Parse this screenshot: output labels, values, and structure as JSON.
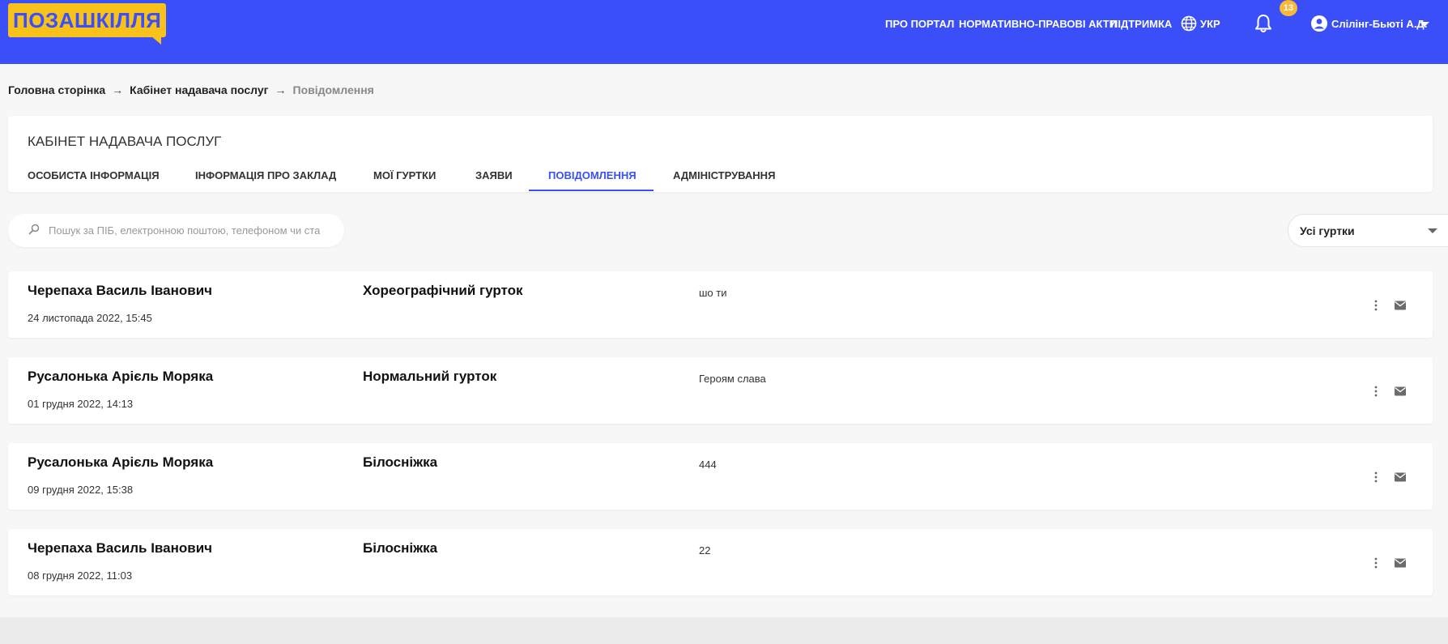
{
  "header": {
    "logo_text": "ПОЗАШКІЛЛЯ",
    "nav": [
      {
        "label": "ПРО ПОРТАЛ"
      },
      {
        "label": "НОРМАТИВНО-ПРАВОВІ АКТИ"
      },
      {
        "label": "ПІДТРИМКА"
      }
    ],
    "language": "УКР",
    "notifications_count": "13",
    "user_name": "Слілінг-Бьюті А.Д."
  },
  "breadcrumb": {
    "home": "Головна сторінка",
    "cabinet": "Кабінет надавача послуг",
    "current": "Повідомлення"
  },
  "cabinet": {
    "title": "КАБІНЕТ НАДАВАЧА ПОСЛУГ",
    "tabs": [
      {
        "label": "ОСОБИСТА ІНФОРМАЦІЯ"
      },
      {
        "label": "ІНФОРМАЦІЯ ПРО ЗАКЛАД"
      },
      {
        "label": "МОЇ ГУРТКИ"
      },
      {
        "label": "ЗАЯВИ"
      },
      {
        "label": "ПОВІДОМЛЕННЯ"
      },
      {
        "label": "АДМІНІСТРУВАННЯ"
      }
    ],
    "active_tab": "ПОВІДОМЛЕННЯ"
  },
  "search": {
    "placeholder": "Пошук за ПІБ, електронною поштою, телефоном чи ста",
    "value": ""
  },
  "filter": {
    "selected": "Усі гуртки"
  },
  "messages": [
    {
      "sender": "Черепаха Василь Іванович",
      "date": "24 листопада 2022, 15:45",
      "club": "Хореографічний гурток",
      "text": "шо ти"
    },
    {
      "sender": "Русалонька Арієль Моряка",
      "date": "01 грудня 2022, 14:13",
      "club": "Нормальний гурток",
      "text": "Героям слава"
    },
    {
      "sender": "Русалонька Арієль Моряка",
      "date": "09 грудня 2022, 15:38",
      "club": "Білосніжка",
      "text": "444"
    },
    {
      "sender": "Черепаха Василь Іванович",
      "date": "08 грудня 2022, 11:03",
      "club": "Білосніжка",
      "text": "22"
    }
  ],
  "colors": {
    "primary": "#3a4ff7",
    "logo_bg": "#f8c21a",
    "badge": "#f8b93a",
    "page_bg": "#f7f7f7"
  },
  "icons": [
    "globe-icon",
    "bell-icon",
    "user-circle-icon",
    "chevron-down-icon",
    "arrow-right-icon",
    "search-icon",
    "more-vertical-icon",
    "mail-icon"
  ]
}
